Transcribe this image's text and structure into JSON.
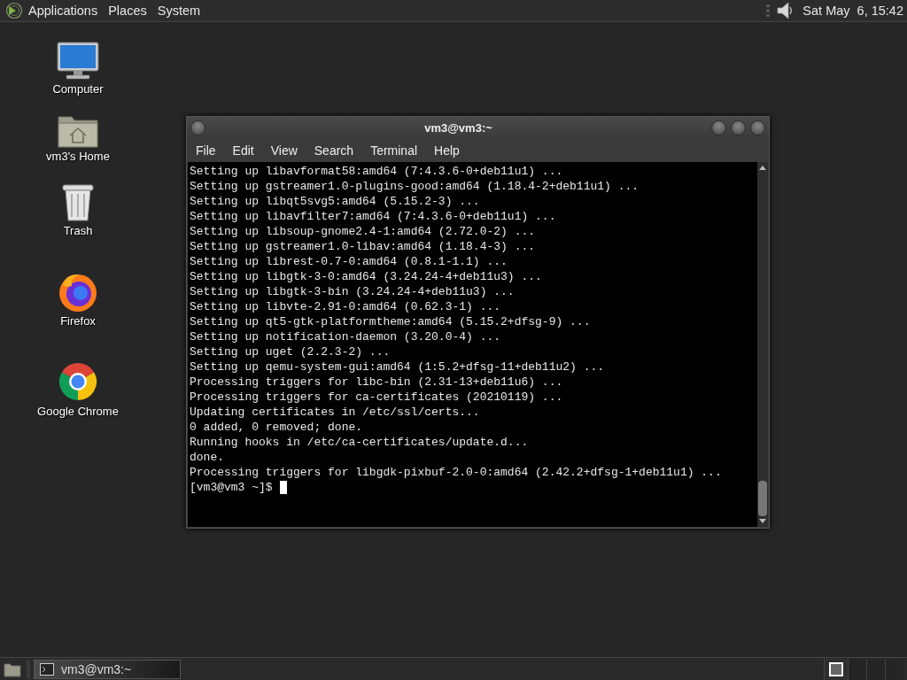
{
  "top_panel": {
    "menus": [
      "Applications",
      "Places",
      "System"
    ],
    "clock": "Sat May  6, 15:42"
  },
  "desktop_icons": [
    {
      "label": "Computer",
      "kind": "computer"
    },
    {
      "label": "vm3's Home",
      "kind": "home"
    },
    {
      "label": "Trash",
      "kind": "trash"
    },
    {
      "label": "Firefox",
      "kind": "firefox"
    },
    {
      "label": "Google Chrome",
      "kind": "chrome"
    }
  ],
  "terminal_window": {
    "title": "vm3@vm3:~",
    "menu": [
      "File",
      "Edit",
      "View",
      "Search",
      "Terminal",
      "Help"
    ],
    "lines": [
      "Setting up libavformat58:amd64 (7:4.3.6-0+deb11u1) ...",
      "Setting up gstreamer1.0-plugins-good:amd64 (1.18.4-2+deb11u1) ...",
      "Setting up libqt5svg5:amd64 (5.15.2-3) ...",
      "Setting up libavfilter7:amd64 (7:4.3.6-0+deb11u1) ...",
      "Setting up libsoup-gnome2.4-1:amd64 (2.72.0-2) ...",
      "Setting up gstreamer1.0-libav:amd64 (1.18.4-3) ...",
      "Setting up librest-0.7-0:amd64 (0.8.1-1.1) ...",
      "Setting up libgtk-3-0:amd64 (3.24.24-4+deb11u3) ...",
      "Setting up libgtk-3-bin (3.24.24-4+deb11u3) ...",
      "Setting up libvte-2.91-0:amd64 (0.62.3-1) ...",
      "Setting up qt5-gtk-platformtheme:amd64 (5.15.2+dfsg-9) ...",
      "Setting up notification-daemon (3.20.0-4) ...",
      "Setting up uget (2.2.3-2) ...",
      "Setting up qemu-system-gui:amd64 (1:5.2+dfsg-11+deb11u2) ...",
      "Processing triggers for libc-bin (2.31-13+deb11u6) ...",
      "Processing triggers for ca-certificates (20210119) ...",
      "Updating certificates in /etc/ssl/certs...",
      "0 added, 0 removed; done.",
      "Running hooks in /etc/ca-certificates/update.d...",
      "done.",
      "Processing triggers for libgdk-pixbuf-2.0-0:amd64 (2.42.2+dfsg-1+deb11u1) ..."
    ],
    "prompt": "[vm3@vm3 ~]$"
  },
  "taskbar": {
    "tasks": [
      {
        "label": "vm3@vm3:~",
        "selected": true
      }
    ],
    "workspaces": [
      {
        "selected": true
      },
      {
        "selected": false
      },
      {
        "selected": false
      },
      {
        "selected": false
      }
    ]
  }
}
